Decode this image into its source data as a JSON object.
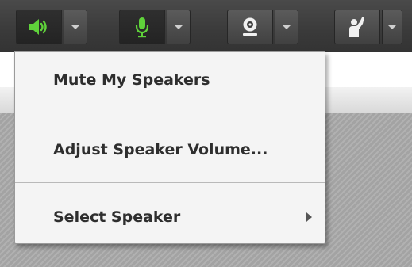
{
  "toolbar": {
    "buttons": [
      {
        "name": "speaker",
        "icon": "speaker-icon",
        "state": "active",
        "icon_color": "#5fd23a"
      },
      {
        "name": "microphone",
        "icon": "microphone-icon",
        "state": "active",
        "icon_color": "#5fd23a"
      },
      {
        "name": "webcam",
        "icon": "webcam-icon",
        "state": "default",
        "icon_color": "#f0f0f0"
      },
      {
        "name": "raise-hand",
        "icon": "raise-hand-icon",
        "state": "default",
        "icon_color": "#f0f0f0"
      }
    ],
    "dropdown_icon": "chevron-down-icon"
  },
  "speaker_menu": {
    "items": [
      {
        "label": "Mute My Speakers"
      },
      {
        "label": "Adjust Speaker Volume..."
      },
      {
        "label": "Select Speaker",
        "submenu_icon": "chevron-right-icon"
      }
    ]
  },
  "colors": {
    "toolbar_bg": "#3a3a3a",
    "active_green": "#5fd23a",
    "menu_bg": "#f4f4f4",
    "menu_text": "#2e2e2e"
  }
}
